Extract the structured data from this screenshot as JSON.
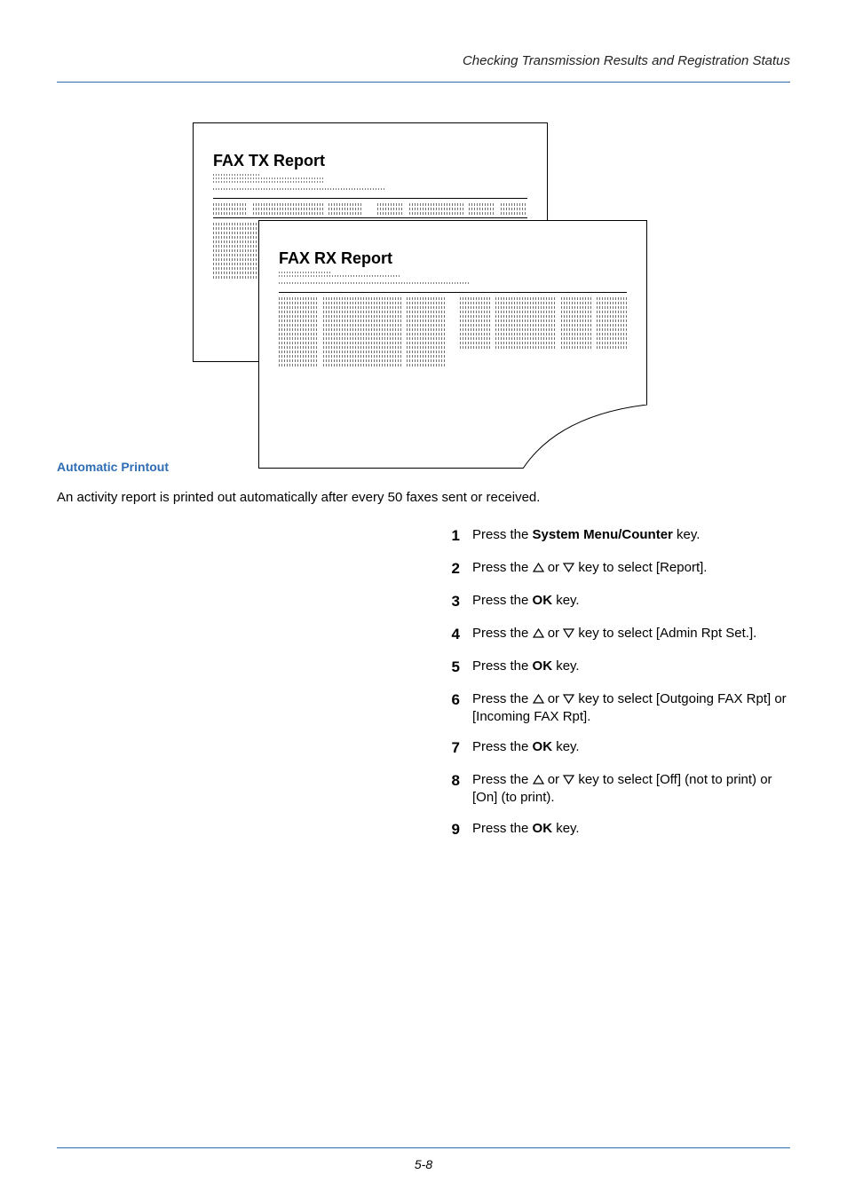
{
  "header": {
    "title": "Checking Transmission Results and Registration Status"
  },
  "illustration": {
    "report1_title": "FAX TX Report",
    "report2_title": "FAX RX Report"
  },
  "section": {
    "title": "Automatic Printout",
    "intro": "An activity report is printed out automatically after every 50 faxes sent or received."
  },
  "labels": {
    "press_the": "Press the ",
    "or_word": " or ",
    "key_to_select": " key to select ",
    "period": ".",
    "ok_word": "OK",
    "key_word": " key.",
    "system_menu": "System Menu/Counter"
  },
  "steps": [
    {
      "num": "1",
      "type": "press_bold_key",
      "bold": "System Menu/Counter",
      "tail": " key."
    },
    {
      "num": "2",
      "type": "arrow_select",
      "target": "[Report]."
    },
    {
      "num": "3",
      "type": "press_ok"
    },
    {
      "num": "4",
      "type": "arrow_select",
      "target": "[Admin Rpt Set.]."
    },
    {
      "num": "5",
      "type": "press_ok"
    },
    {
      "num": "6",
      "type": "arrow_select",
      "target": "[Outgoing FAX Rpt] or [Incoming FAX Rpt]."
    },
    {
      "num": "7",
      "type": "press_ok"
    },
    {
      "num": "8",
      "type": "arrow_select",
      "target": "[Off] (not to print) or [On] (to print)."
    },
    {
      "num": "9",
      "type": "press_ok"
    }
  ],
  "footer": {
    "page": "5-8"
  }
}
